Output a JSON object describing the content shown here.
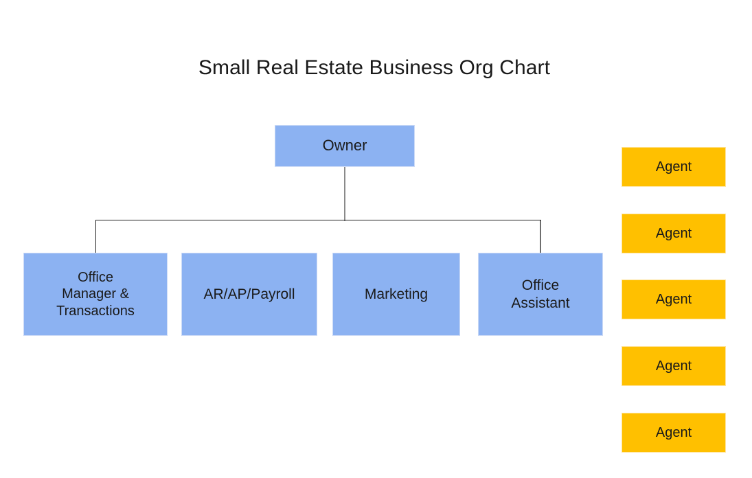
{
  "chart": {
    "title": "Small Real Estate Business Org Chart",
    "type": "org-chart",
    "background_color": "#ffffff",
    "node_colors": {
      "blue_fill": "#8cb2f2",
      "blue_border": "#cbdaf6",
      "amber_fill": "#ffc000",
      "amber_border": "#ffe39a",
      "connector_black": "#1f1f1f",
      "connector_gray": "#8a8a8a",
      "text": "#1a1a1a"
    }
  },
  "nodes": {
    "root": {
      "label": "Owner",
      "color": "blue"
    },
    "children": [
      {
        "label": "Office\nManager &\nTransactions",
        "color": "blue"
      },
      {
        "label": "AR/AP/Payroll",
        "color": "blue"
      },
      {
        "label": "Marketing",
        "color": "blue"
      },
      {
        "label": "Office\nAssistant",
        "color": "blue"
      }
    ],
    "agents": [
      {
        "label": "Agent",
        "color": "amber"
      },
      {
        "label": "Agent",
        "color": "amber"
      },
      {
        "label": "Agent",
        "color": "amber"
      },
      {
        "label": "Agent",
        "color": "amber"
      },
      {
        "label": "Agent",
        "color": "amber"
      }
    ]
  }
}
